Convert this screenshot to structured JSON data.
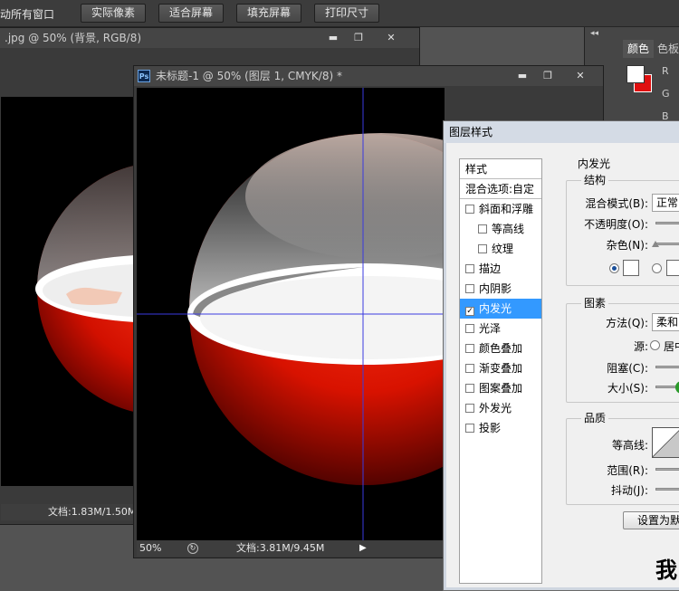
{
  "options_bar": {
    "scroll_all_label": "滚动所有窗口",
    "actual_pixels": "实际像素",
    "fit_screen": "适合屏幕",
    "fill_screen": "填充屏幕",
    "print_size": "打印尺寸"
  },
  "doc_back": {
    "tab_title": ".jpg @ 50% (背景, RGB/8)",
    "status_doc": "文档:1.83M/1.50M"
  },
  "doc_front": {
    "ps_badge": "Ps",
    "tab_title": "未标题-1 @ 50% (图层 1, CMYK/8) *",
    "zoom": "50%",
    "status_doc": "文档:3.81M/9.45M"
  },
  "color_panel": {
    "tab_color": "颜色",
    "tab_swatches": "色板",
    "channel_r": "R",
    "channel_g": "G",
    "channel_b": "B"
  },
  "dialog": {
    "title": "图层样式",
    "styles_header": "样式",
    "blend_options": "混合选项:自定",
    "items": [
      {
        "label": "斜面和浮雕",
        "checked": false,
        "indent": false
      },
      {
        "label": "等高线",
        "checked": false,
        "indent": true
      },
      {
        "label": "纹理",
        "checked": false,
        "indent": true
      },
      {
        "label": "描边",
        "checked": false,
        "indent": false
      },
      {
        "label": "内阴影",
        "checked": false,
        "indent": false
      },
      {
        "label": "内发光",
        "checked": true,
        "indent": false
      },
      {
        "label": "光泽",
        "checked": false,
        "indent": false
      },
      {
        "label": "颜色叠加",
        "checked": false,
        "indent": false
      },
      {
        "label": "渐变叠加",
        "checked": false,
        "indent": false
      },
      {
        "label": "图案叠加",
        "checked": false,
        "indent": false
      },
      {
        "label": "外发光",
        "checked": false,
        "indent": false
      },
      {
        "label": "投影",
        "checked": false,
        "indent": false
      }
    ],
    "section_title": "内发光",
    "structure": {
      "title": "结构",
      "blend_mode_label": "混合模式(B):",
      "blend_mode_value": "正常",
      "opacity_label": "不透明度(O):",
      "noise_label": "杂色(N):"
    },
    "elements": {
      "title": "图素",
      "technique_label": "方法(Q):",
      "technique_value": "柔和",
      "source_label": "源:",
      "source_center": "居中",
      "choke_label": "阻塞(C):",
      "size_label": "大小(S):"
    },
    "quality": {
      "title": "品质",
      "contour_label": "等高线:",
      "range_label": "范围(R):",
      "jitter_label": "抖动(J):"
    },
    "set_default_button": "设置为默",
    "watermark": "我"
  },
  "colors": {
    "accent_red": "#e01010",
    "guide_blue": "#3a3adf",
    "selection_blue": "#3399ff"
  }
}
